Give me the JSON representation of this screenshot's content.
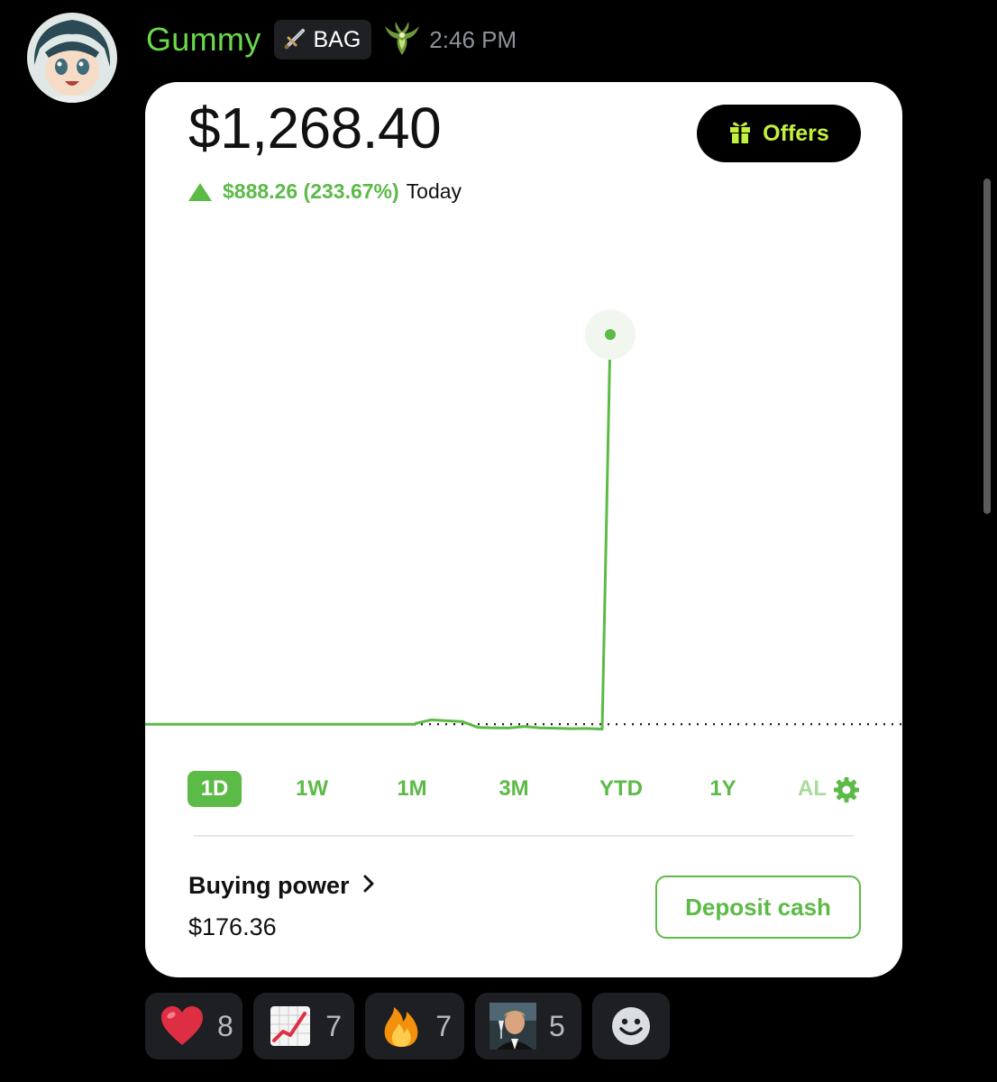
{
  "message": {
    "username": "Gummy",
    "role_tag": "BAG",
    "timestamp": "2:46 PM",
    "username_color": "#6bd94b"
  },
  "portfolio": {
    "balance": "$1,268.40",
    "offers_label": "Offers",
    "gain": "$888.26 (233.67%)",
    "gain_period": "Today",
    "accent_color": "#5cba47",
    "tabs": [
      {
        "label": "1D",
        "active": true
      },
      {
        "label": "1W",
        "active": false
      },
      {
        "label": "1M",
        "active": false
      },
      {
        "label": "3M",
        "active": false
      },
      {
        "label": "YTD",
        "active": false
      },
      {
        "label": "1Y",
        "active": false
      },
      {
        "label": "AL",
        "active": false
      }
    ],
    "buying_power_label": "Buying power",
    "buying_power_value": "$176.36",
    "deposit_label": "Deposit cash"
  },
  "reactions": [
    {
      "emoji": "heart-icon",
      "count": "8"
    },
    {
      "emoji": "chart-increasing-icon",
      "count": "7"
    },
    {
      "emoji": "fire-icon",
      "count": "7"
    },
    {
      "emoji": "toast-custom-emoji",
      "count": "5"
    }
  ],
  "chart_data": {
    "type": "line",
    "title": "",
    "xlabel": "",
    "ylabel": "",
    "baseline_value": 380.14,
    "values": [
      380.1,
      380.1,
      380.1,
      380.1,
      380.1,
      380.1,
      380.1,
      382.0,
      390.0,
      388.0,
      386.0,
      373.0,
      372.0,
      371.5,
      375.0,
      372.0,
      371.0,
      370.0,
      370.5,
      369.0,
      1268.4
    ],
    "series_color": "#5cba47",
    "grid": false
  }
}
